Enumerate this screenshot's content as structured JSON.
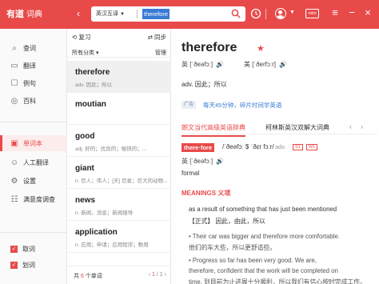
{
  "app": {
    "logo": "有道",
    "logo_sub": "词典",
    "back": "‹",
    "forward": "›"
  },
  "search": {
    "lang": "英汉互译",
    "query": "therefore"
  },
  "toolbar": {
    "mini": "mini"
  },
  "colors": {
    "brand": "#e84a4a",
    "link": "#3a7bd5"
  },
  "sidebar": {
    "items": [
      {
        "label": "查词",
        "icon": "search-icon"
      },
      {
        "label": "翻译",
        "icon": "translate-icon"
      },
      {
        "label": "例句",
        "icon": "sentence-icon"
      },
      {
        "label": "百科",
        "icon": "encyclopedia-icon"
      },
      {
        "label": "单词本",
        "icon": "wordbook-icon"
      },
      {
        "label": "人工翻译",
        "icon": "human-translate-icon"
      },
      {
        "label": "设置",
        "icon": "gear-icon"
      },
      {
        "label": "满意度调查",
        "icon": "survey-icon"
      }
    ],
    "checks": [
      {
        "label": "取词"
      },
      {
        "label": "划词"
      }
    ]
  },
  "wordlist": {
    "review": "复习",
    "sync": "同步",
    "category": "所有分类",
    "manage": "管理",
    "words": [
      {
        "word": "therefore",
        "def": "adv. 因此；所以"
      },
      {
        "word": "moutian",
        "def": ""
      },
      {
        "word": "good",
        "def": "adj. 好的；优良的；愉快的；..."
      },
      {
        "word": "giant",
        "def": "n. 巨人；伟人；[天] 巨星；巨大的动物..."
      },
      {
        "word": "news",
        "def": "n. 新闻，消息；新闻报导"
      },
      {
        "word": "application",
        "def": "n. 应用；申请；应用程序；敷用"
      }
    ],
    "count_prefix": "共",
    "count": "6",
    "count_suffix": "个单词",
    "page": "1",
    "pages": "/ 1"
  },
  "entry": {
    "headword": "therefore",
    "uk_label": "英 [ˈðeəfɔː]",
    "us_label": "美 [ˈðerfɔːr]",
    "definition": "adv. 因此；所以",
    "ad_badge": "广告",
    "ad_text": "每天45分钟，碎片时间学英语",
    "tabs": [
      "朗文当代高级英语辞典",
      "柯林斯英汉双解大词典"
    ],
    "syllables": "there·fore",
    "ipa": "/ˈðeəfɔː $ ˈðɛr fɔːr/",
    "pos": "adv.",
    "level1": "S1",
    "level2": "W1",
    "uk2": "英 [ˈðeəfɔː]",
    "register": "formal",
    "meanings_title": "MEANINGS 义项",
    "sense": "as a result of something that has just been mentioned",
    "sense_cn": "【正式】 因此，由此，所以",
    "examples": [
      {
        "en": "Their car was bigger and therefore more comfortable.",
        "cn": "他们的车大些，所以更舒适些。"
      },
      {
        "en": "Progress so far has been very good. We are,",
        "en2": "therefore, confident that the work will be completed on",
        "cn": "time. 到目前为止进展十分顺利，所以我们有信心按时完成工作。"
      }
    ]
  }
}
